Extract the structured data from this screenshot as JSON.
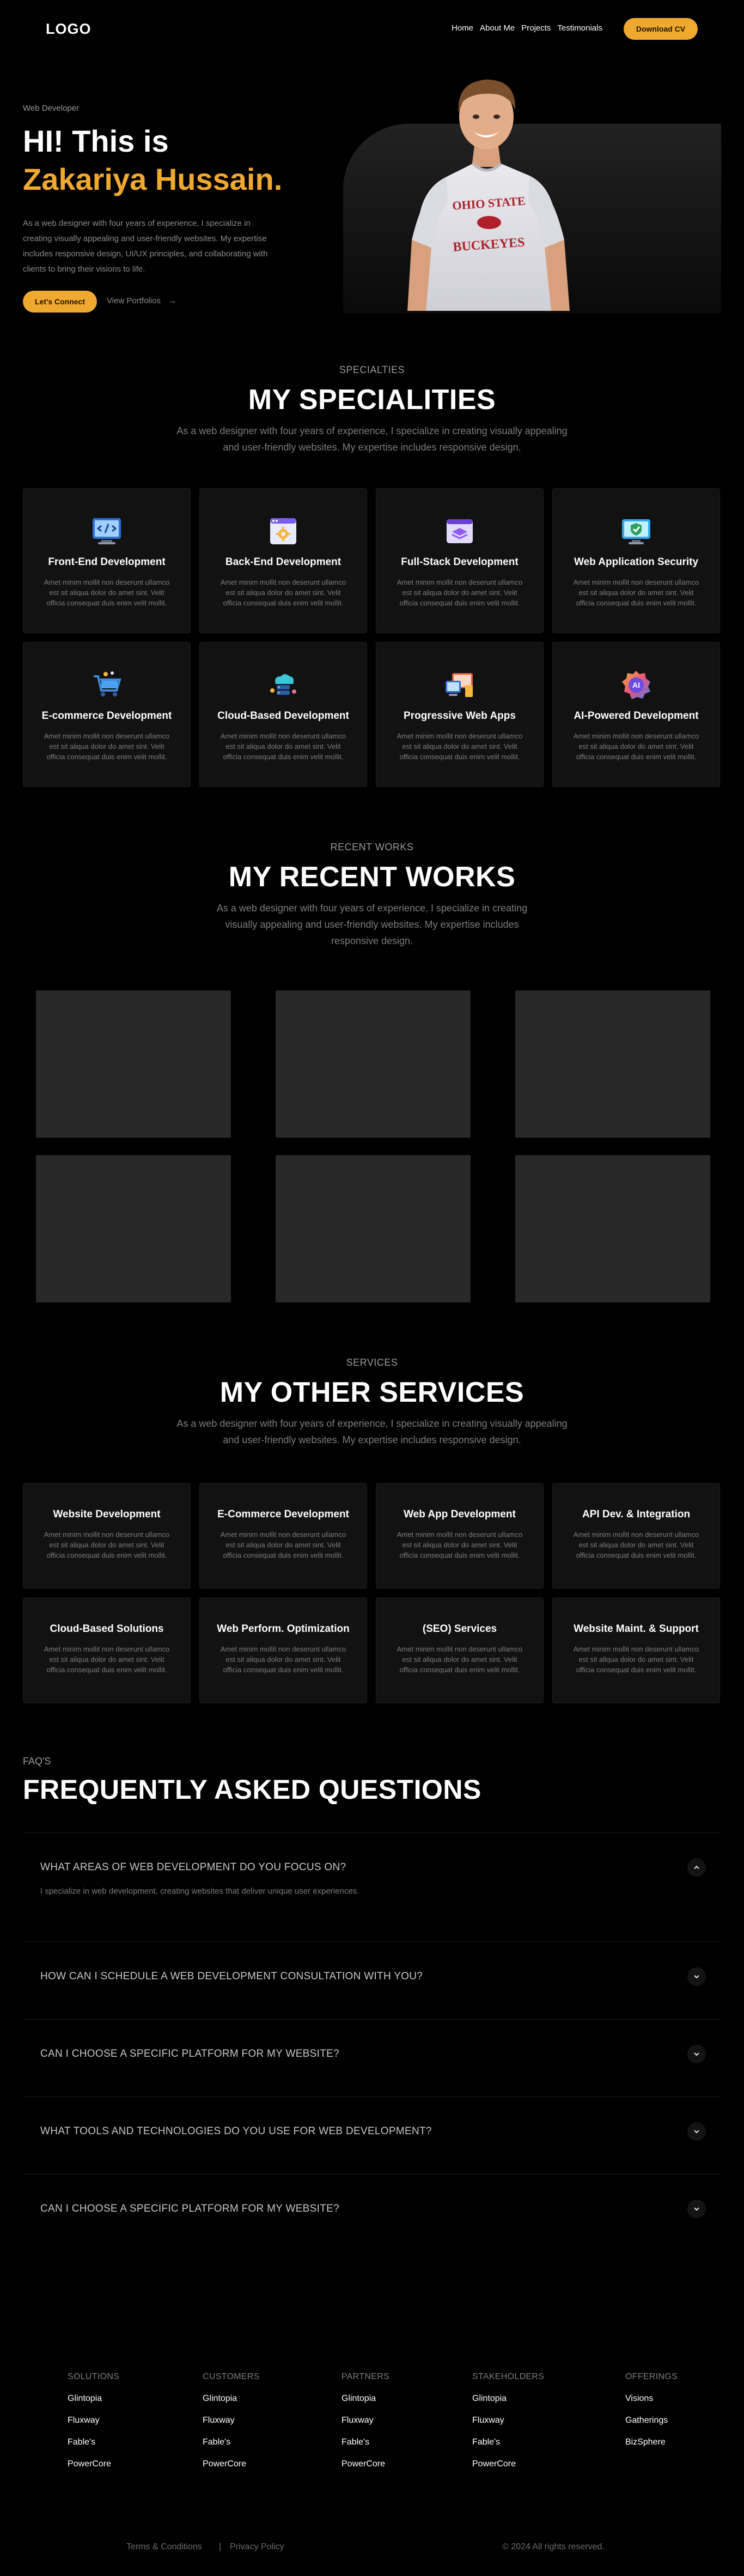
{
  "nav": {
    "logo": "LOGO",
    "links": [
      "Home",
      "About Me",
      "Projects",
      "Testimonials"
    ],
    "cv_button": "Download CV"
  },
  "hero": {
    "kicker": "Web Developer",
    "greeting": "HI! This is",
    "name": "Zakariya Hussain.",
    "description": "As a web designer with four years of experience, I specialize in creating visually appealing and user-friendly websites. My expertise includes responsive design, UI/UX principles, and collaborating with clients to bring their visions to life.",
    "connect_button": "Let's Connect",
    "portfolio_link": "View Portfolios",
    "shirt_text_1": "OHIO STATE",
    "shirt_text_2": "BUCKEYES"
  },
  "specialties": {
    "tag": "SPECIALTIES",
    "title": "MY SPECIALITIES",
    "description": "As a web designer with four years of experience, I specialize in creating visually appealing and user-friendly websites. My expertise includes responsive design.",
    "cards": [
      {
        "title": "Front-End Development",
        "text": "Amet minim mollit non deserunt ullamco est sit aliqua dolor do amet sint. Velit officia consequat duis enim velit mollit.",
        "icon": "monitor-code-icon"
      },
      {
        "title": "Back-End Development",
        "text": "Amet minim mollit non deserunt ullamco est sit aliqua dolor do amet sint. Velit officia consequat duis enim velit mollit.",
        "icon": "browser-gear-icon"
      },
      {
        "title": "Full-Stack Development",
        "text": "Amet minim mollit non deserunt ullamco est sit aliqua dolor do amet sint. Velit officia consequat duis enim velit mollit.",
        "icon": "layers-window-icon"
      },
      {
        "title": "Web Application Security",
        "text": "Amet minim mollit non deserunt ullamco est sit aliqua dolor do amet sint. Velit officia consequat duis enim velit mollit.",
        "icon": "shield-monitor-icon"
      },
      {
        "title": "E-commerce Development",
        "text": "Amet minim mollit non deserunt ullamco est sit aliqua dolor do amet sint. Velit officia consequat duis enim velit mollit.",
        "icon": "shopping-cart-icon"
      },
      {
        "title": "Cloud-Based Development",
        "text": "Amet minim mollit non deserunt ullamco est sit aliqua dolor do amet sint. Velit officia consequat duis enim velit mollit.",
        "icon": "cloud-server-icon"
      },
      {
        "title": "Progressive Web Apps",
        "text": "Amet minim mollit non deserunt ullamco est sit aliqua dolor do amet sint. Velit officia consequat duis enim velit mollit.",
        "icon": "devices-icon"
      },
      {
        "title": "AI-Powered Development",
        "text": "Amet minim mollit non deserunt ullamco est sit aliqua dolor do amet sint. Velit officia consequat duis enim velit mollit.",
        "icon": "ai-badge-icon"
      }
    ]
  },
  "works": {
    "tag": "RECENT WORKS",
    "title": "MY RECENT WORKS",
    "description": "As a web designer with four years of experience, I specialize in creating visually appealing and user-friendly websites. My expertise includes responsive design."
  },
  "services": {
    "tag": "SERVICES",
    "title": "MY OTHER SERVICES",
    "description": "As a web designer with four years of experience, I specialize in creating visually appealing and user-friendly websites. My expertise includes responsive design.",
    "cards": [
      {
        "title": "Website Development",
        "text": "Amet minim mollit non deserunt ullamco est sit aliqua dolor do amet sint. Velit officia consequat duis enim velit mollit."
      },
      {
        "title": "E-Commerce Development",
        "text": "Amet minim mollit non deserunt ullamco est sit aliqua dolor do amet sint. Velit officia consequat duis enim velit mollit."
      },
      {
        "title": "Web App Development",
        "text": "Amet minim mollit non deserunt ullamco est sit aliqua dolor do amet sint. Velit officia consequat duis enim velit mollit."
      },
      {
        "title": "API Dev. & Integration",
        "text": "Amet minim mollit non deserunt ullamco est sit aliqua dolor do amet sint. Velit officia consequat duis enim velit mollit."
      },
      {
        "title": "Cloud-Based Solutions",
        "text": "Amet minim mollit non deserunt ullamco est sit aliqua dolor do amet sint. Velit officia consequat duis enim velit mollit."
      },
      {
        "title": "Web Perform. Optimization",
        "text": "Amet minim mollit non deserunt ullamco est sit aliqua dolor do amet sint. Velit officia consequat duis enim velit mollit."
      },
      {
        "title": "(SEO) Services",
        "text": "Amet minim mollit non deserunt ullamco est sit aliqua dolor do amet sint. Velit officia consequat duis enim velit mollit."
      },
      {
        "title": "Website Maint. & Support",
        "text": "Amet minim mollit non deserunt ullamco est sit aliqua dolor do amet sint. Velit officia consequat duis enim velit mollit."
      }
    ]
  },
  "faq": {
    "tag": "FAQ'S",
    "title": "FREQUENTLY ASKED QUESTIONS",
    "items": [
      {
        "question": "WHAT AREAS OF WEB DEVELOPMENT DO YOU FOCUS ON?",
        "answer": "I specialize in web development, creating websites that deliver unique user experiences.",
        "open": true
      },
      {
        "question": "HOW CAN I SCHEDULE A WEB DEVELOPMENT CONSULTATION WITH YOU?",
        "answer": "",
        "open": false
      },
      {
        "question": "CAN I CHOOSE A SPECIFIC PLATFORM FOR MY WEBSITE?",
        "answer": "",
        "open": false
      },
      {
        "question": "WHAT TOOLS AND TECHNOLOGIES DO YOU USE FOR WEB DEVELOPMENT?",
        "answer": "",
        "open": false
      },
      {
        "question": "CAN I CHOOSE A SPECIFIC PLATFORM FOR MY WEBSITE?",
        "answer": "",
        "open": false
      }
    ]
  },
  "footer": {
    "columns": [
      {
        "heading": "SOLUTIONS",
        "items": [
          "Glintopia",
          "Fluxway",
          "Fable's",
          "PowerCore"
        ]
      },
      {
        "heading": "CUSTOMERS",
        "items": [
          "Glintopia",
          "Fluxway",
          "Fable's",
          "PowerCore"
        ]
      },
      {
        "heading": "PARTNERS",
        "items": [
          "Glintopia",
          "Fluxway",
          "Fable's",
          "PowerCore"
        ]
      },
      {
        "heading": "STAKEHOLDERS",
        "items": [
          "Glintopia",
          "Fluxway",
          "Fable's",
          "PowerCore"
        ]
      },
      {
        "heading": "OFFERINGS",
        "items": [
          "Visions",
          "Gatherings",
          "BizSphere"
        ]
      }
    ],
    "terms": "Terms & Conditions",
    "privacy": "Privacy Policy",
    "copyright": "© 2024 All rights reserved."
  },
  "colors": {
    "accent": "#f0a92f",
    "background": "#000000",
    "card": "#121212",
    "tile": "#292929"
  }
}
